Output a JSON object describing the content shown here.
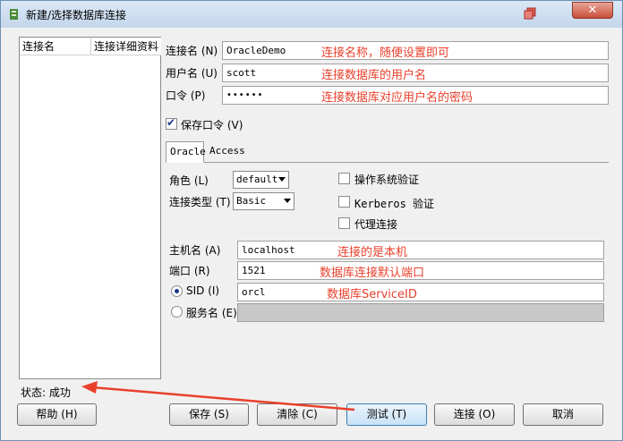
{
  "window": {
    "title": "新建/选择数据库连接",
    "close_label": "✕"
  },
  "conn_list": {
    "columns": [
      "连接名",
      "连接详细资料"
    ]
  },
  "form": {
    "conn_name_label": "连接名 (N)",
    "conn_name_value": "OracleDemo",
    "conn_name_note": "连接名称，随便设置即可",
    "username_label": "用户名 (U)",
    "username_value": "scott",
    "username_note": "连接数据库的用户名",
    "password_label": "口令 (P)",
    "password_value": "••••••",
    "password_note": "连接数据库对应用户名的密码",
    "save_password_label": "保存口令 (V)"
  },
  "tabs": [
    {
      "label": "Oracle"
    },
    {
      "label": "Access"
    }
  ],
  "oracle": {
    "role_label": "角色 (L)",
    "role_value": "default",
    "conn_type_label": "连接类型 (T)",
    "conn_type_value": "Basic",
    "os_auth_label": "操作系统验证",
    "kerberos_label": "Kerberos 验证",
    "proxy_label": "代理连接",
    "host_label": "主机名 (A)",
    "host_value": "localhost",
    "host_note": "连接的是本机",
    "port_label": "端口 (R)",
    "port_value": "1521",
    "port_note": "数据库连接默认端口",
    "sid_label": "SID (I)",
    "sid_value": "orcl",
    "sid_note": "数据库ServiceID",
    "service_label": "服务名 (E)"
  },
  "status": {
    "text": "状态:  成功"
  },
  "buttons": {
    "help": "帮助 (H)",
    "save": "保存 (S)",
    "clear": "清除 (C)",
    "test": "测试 (T)",
    "connect": "连接 (O)",
    "cancel": "取消"
  },
  "colors": {
    "annotation": "#e8402c",
    "accent": "#1a3a8a"
  }
}
